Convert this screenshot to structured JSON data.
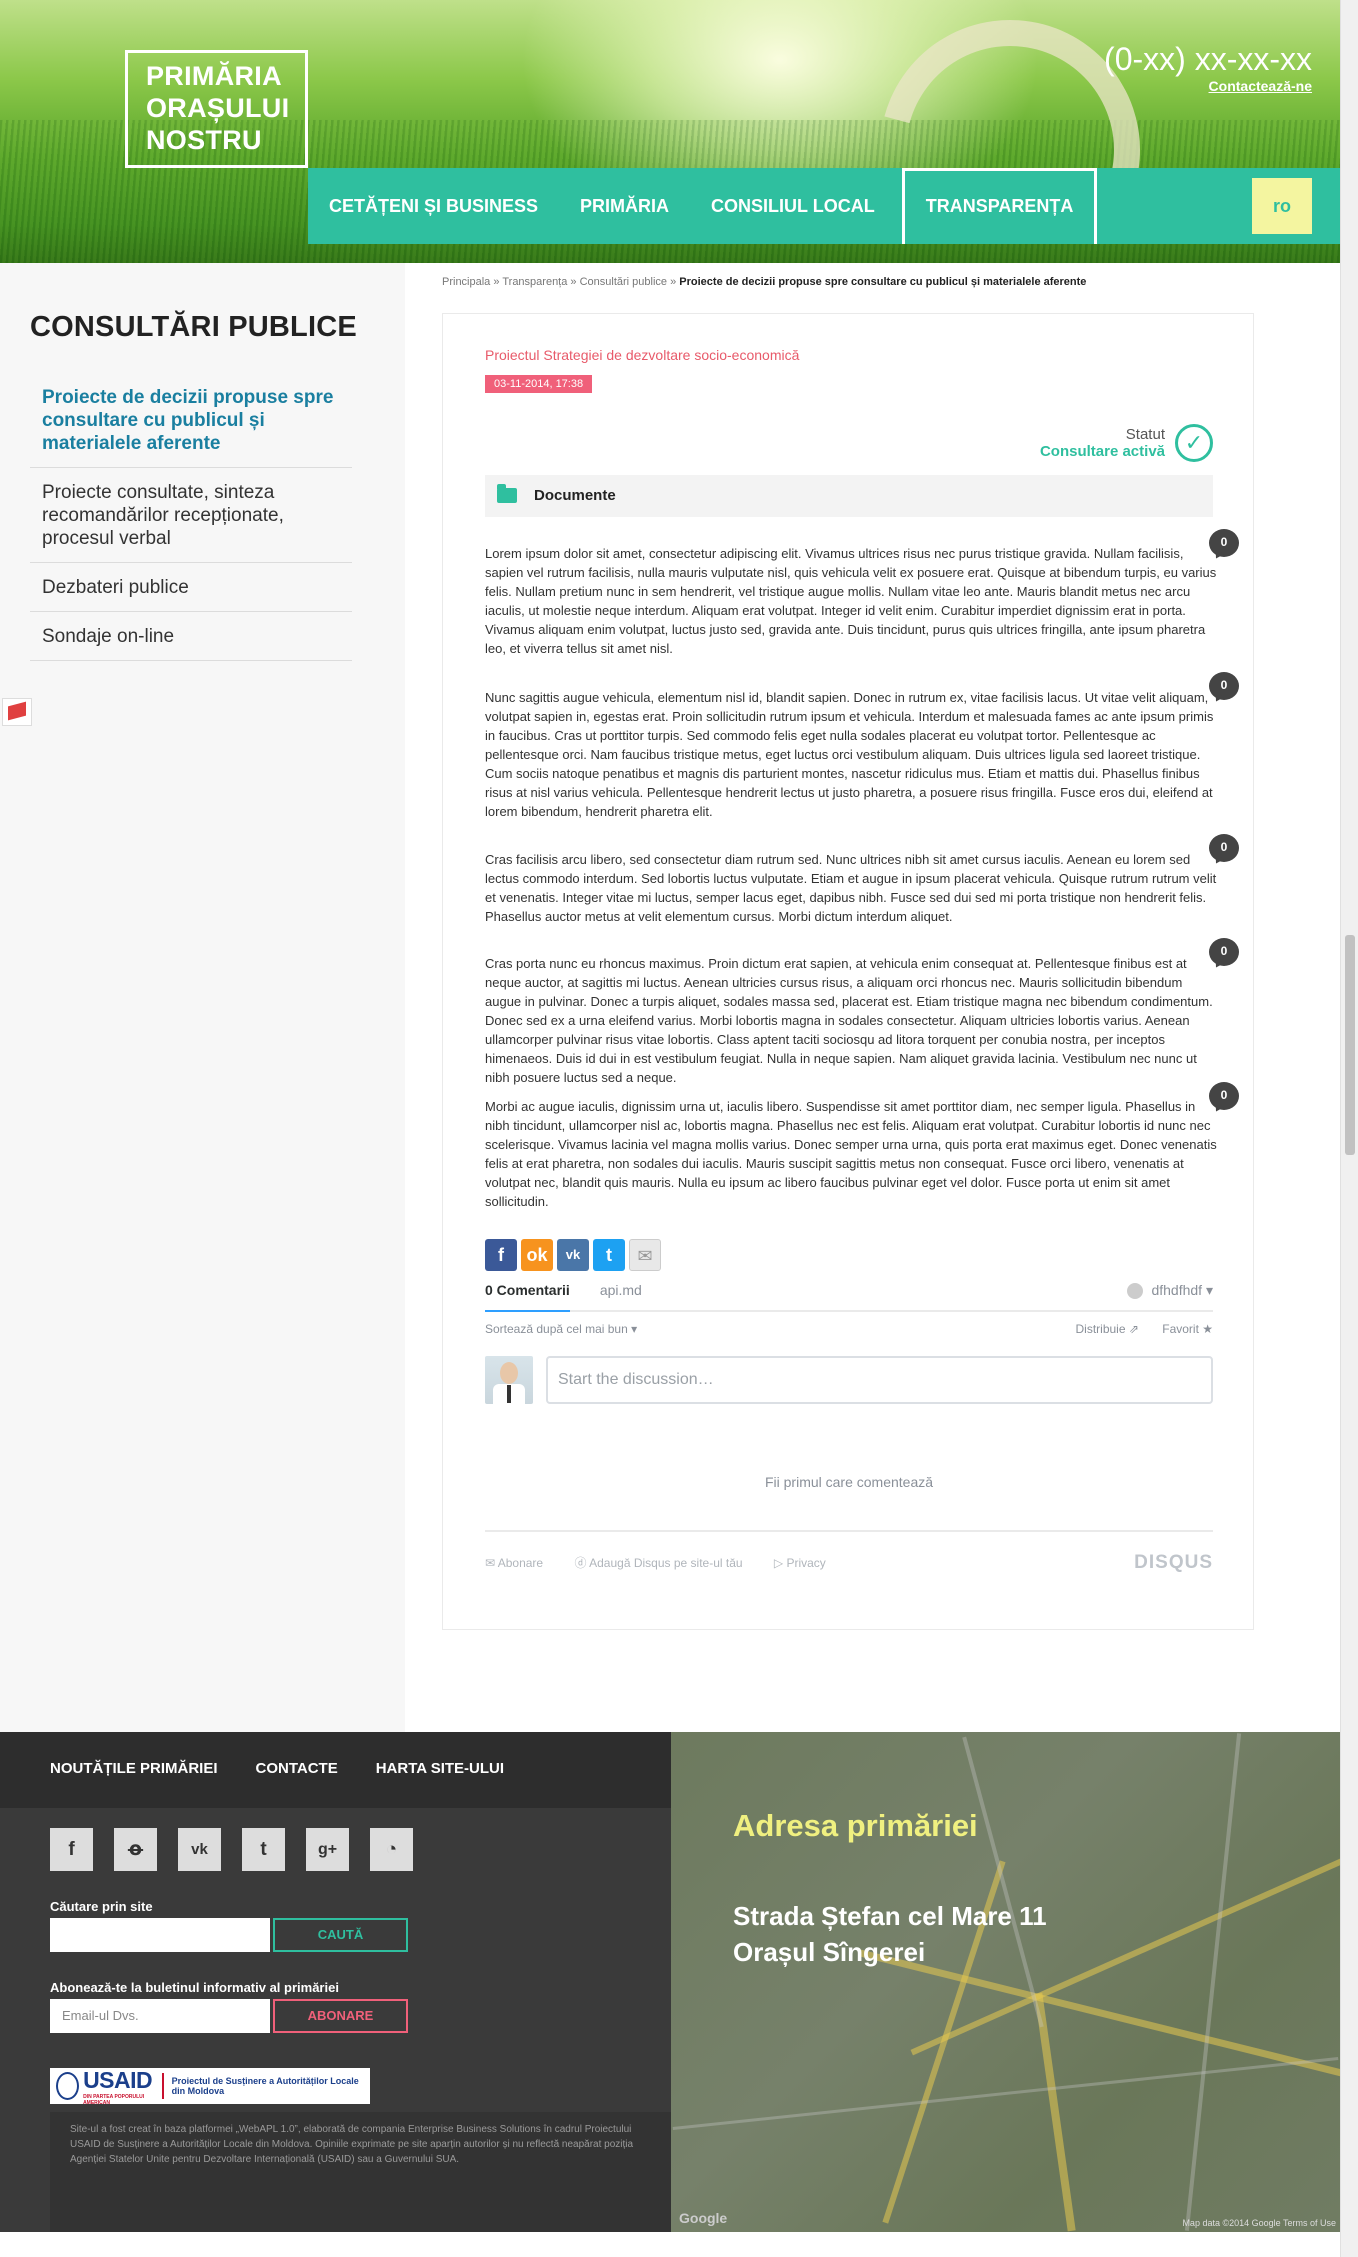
{
  "header": {
    "logo_lines": [
      "PRIMĂRIA",
      "ORAȘULUI",
      "NOSTRU"
    ],
    "phone": "(0-xx) xx-xx-xx",
    "contact_link": "Contactează-ne",
    "nav": [
      "CETĂȚENI ȘI BUSINESS",
      "PRIMĂRIA",
      "CONSILIUL LOCAL",
      "TRANSPARENȚA"
    ],
    "lang": "ro"
  },
  "sidebar": {
    "title": "CONSULTĂRI PUBLICE",
    "items": [
      "Proiecte de decizii propuse spre consultare cu publicul și materialele aferente",
      "Proiecte consultate, sinteza recomandărilor recepționate, procesul verbal",
      "Dezbateri publice",
      "Sondaje on-line"
    ]
  },
  "breadcrumb": {
    "items": [
      "Principala",
      "Transparența",
      "Consultări publice"
    ],
    "current": "Proiecte de decizii propuse spre consultare cu publicul și materialele aferente",
    "separator": " » "
  },
  "article": {
    "title": "Proiectul Strategiei de dezvoltare socio-economică",
    "date": "03-11-2014, 17:38",
    "status_label": "Statut",
    "status_value": "Consultare activă",
    "documents_label": "Documente",
    "paragraphs": [
      "Lorem ipsum dolor sit amet, consectetur adipiscing elit. Vivamus ultrices risus nec purus tristique gravida. Nullam facilisis, sapien vel rutrum facilisis, nulla mauris vulputate nisl, quis vehicula velit ex posuere erat. Quisque at bibendum turpis, eu varius felis. Nullam pretium nunc in sem hendrerit, vel tristique augue mollis. Nullam vitae leo ante. Mauris blandit metus nec arcu iaculis, ut molestie neque interdum. Aliquam erat volutpat. Integer id velit enim. Curabitur imperdiet dignissim erat in porta. Vivamus aliquam enim volutpat, luctus justo sed, gravida ante. Duis tincidunt, purus quis ultrices fringilla, ante ipsum pharetra leo, et viverra tellus sit amet nisl.",
      "Nunc sagittis augue vehicula, elementum nisl id, blandit sapien. Donec in rutrum ex, vitae facilisis lacus. Ut vitae velit aliquam, volutpat sapien in, egestas erat. Proin sollicitudin rutrum ipsum et vehicula. Interdum et malesuada fames ac ante ipsum primis in faucibus. Cras ut porttitor turpis. Sed commodo felis eget nulla sodales placerat eu volutpat tortor. Pellentesque ac pellentesque orci. Nam faucibus tristique metus, eget luctus orci vestibulum aliquam. Duis ultrices ligula sed laoreet tristique. Cum sociis natoque penatibus et magnis dis parturient montes, nascetur ridiculus mus. Etiam et mattis dui. Phasellus finibus risus at nisl varius vehicula. Pellentesque hendrerit lectus ut justo pharetra, a posuere risus fringilla. Fusce eros dui, eleifend at lorem bibendum, hendrerit pharetra elit.",
      "Cras facilisis arcu libero, sed consectetur diam rutrum sed. Nunc ultrices nibh sit amet cursus iaculis. Aenean eu lorem sed lectus commodo interdum. Sed lobortis luctus vulputate. Etiam et augue in ipsum placerat vehicula. Quisque rutrum rutrum velit et venenatis. Integer vitae mi luctus, semper lacus eget, dapibus nibh. Fusce sed dui sed mi porta tristique non hendrerit felis. Phasellus auctor metus at velit elementum cursus. Morbi dictum interdum aliquet.",
      "Cras porta nunc eu rhoncus maximus. Proin dictum erat sapien, at vehicula enim consequat at. Pellentesque finibus est at neque auctor, at sagittis mi luctus. Aenean ultricies cursus risus, a aliquam orci rhoncus nec. Mauris sollicitudin bibendum augue in pulvinar. Donec a turpis aliquet, sodales massa sed, placerat est. Etiam tristique magna nec bibendum condimentum. Donec sed ex a urna eleifend varius. Morbi lobortis magna in sodales consectetur. Aliquam ultricies lobortis varius. Aenean ullamcorper pulvinar risus vitae lobortis. Class aptent taciti sociosqu ad litora torquent per conubia nostra, per inceptos himenaeos. Duis id dui in est vestibulum feugiat. Nulla in neque sapien. Nam aliquet gravida lacinia. Vestibulum nec nunc ut nibh posuere luctus sed a neque.",
      "Morbi ac augue iaculis, dignissim urna ut, iaculis libero. Suspendisse sit amet porttitor diam, nec semper ligula. Phasellus in nibh tincidunt, ullamcorper nisl ac, lobortis magna. Phasellus nec est felis. Aliquam erat volutpat. Curabitur lobortis id nunc nec scelerisque. Vivamus lacinia vel magna mollis varius. Donec semper urna urna, quis porta erat maximus eget. Donec venenatis felis at erat pharetra, non sodales dui iaculis. Mauris suscipit sagittis metus non consequat. Fusce orci libero, venenatis at volutpat nec, blandit quis mauris. Nulla eu ipsum ac libero faucibus pulvinar eget vel dolor. Fusce porta ut enim sit amet sollicitudin."
    ],
    "comment_counts": [
      "0",
      "0",
      "0",
      "0",
      "0"
    ]
  },
  "share": {
    "icons": [
      "facebook-icon",
      "odnoklassniki-icon",
      "vk-icon",
      "twitter-icon",
      "email-icon"
    ],
    "colors": [
      "#3b5998",
      "#f7931e",
      "#4a76a8",
      "#1da1f2",
      "#e8e8e8"
    ]
  },
  "disqus": {
    "tab_comments": "0 Comentarii",
    "tab_site": "api.md",
    "user": "dfhdfhdf ▾",
    "sort": "Sortează după cel mai bun ▾",
    "share": "Distribuie ⇗",
    "favorite": "Favorit ★",
    "placeholder": "Start the discussion…",
    "first": "Fii primul care comentează",
    "subscribe": "✉ Abonare",
    "add_disqus": "ⓓ Adaugă Disqus pe site-ul tău",
    "privacy": "▷ Privacy",
    "logo": "DISQUS"
  },
  "footer": {
    "nav": [
      "NOUTĂȚILE PRIMĂRIEI",
      "CONTACTE",
      "HARTA SITE-ULUI"
    ],
    "social_icons": [
      "facebook-icon",
      "odnoklassniki-icon",
      "vk-icon",
      "twitter-icon",
      "google-plus-icon",
      "rss-icon"
    ],
    "search_label": "Căutare prin site",
    "search_button": "CAUTĂ",
    "newsletter_label": "Abonează-te la buletinul informativ al primăriei",
    "email_placeholder": "Email-ul Dvs.",
    "subscribe_button": "ABONARE",
    "usaid_word": "USAID",
    "usaid_sub": "DIN PARTEA POPORULUI AMERICAN",
    "usaid_project": "Proiectul de Susținere a Autorităților Locale din Moldova",
    "disclaimer": "Site-ul a fost creat în baza platformei „WebAPL 1.0”, elaborată de compania Enterprise Business Solutions în cadrul Proiectului USAID de Susținere a Autorităților Locale din Moldova. Opiniile exprimate pe site aparțin autorilor și nu reflectă neapărat poziția Agenției Statelor Unite pentru Dezvoltare Internațională (USAID) sau a Guvernului SUA.",
    "map_title": "Adresa primăriei",
    "address_lines": [
      "Strada Ștefan cel Mare 11",
      "Orașul Sîngerei"
    ],
    "map_data": "Map data ©2014 Google   Terms of Use",
    "google": "Google"
  },
  "colors": {
    "teal": "#2fbf9f",
    "pink": "#e85a6a",
    "link_blue": "#1a7fa0",
    "footer_dark": "#3a3a3a",
    "map_title_yellow": "#f0f080"
  }
}
